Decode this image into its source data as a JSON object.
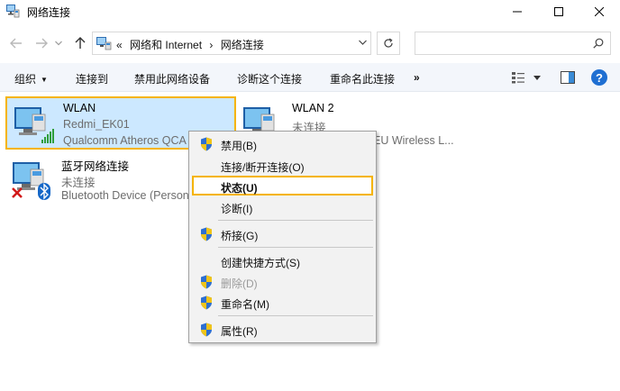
{
  "window": {
    "title": "网络连接",
    "controls": [
      "minimize-icon",
      "maximize-icon",
      "close-icon"
    ]
  },
  "nav": {
    "back_icon": "arrow-left-icon",
    "forward_icon": "arrow-right-icon",
    "recent_icon": "chevron-down-icon",
    "up_icon": "arrow-up-icon",
    "breadcrumb_prefix": "«",
    "breadcrumbs": [
      "网络和 Internet",
      "›",
      "网络连接"
    ],
    "refresh_icon": "refresh-icon",
    "search_placeholder": "",
    "search_icon": "search-icon"
  },
  "toolbar": {
    "organize": "组织",
    "connect_to": "连接到",
    "disable_device": "禁用此网络设备",
    "diagnose": "诊断这个连接",
    "rename": "重命名此连接",
    "more": "»",
    "help": "?"
  },
  "items": [
    {
      "name": "WLAN",
      "status": "Redmi_EK01",
      "device": "Qualcomm Atheros QCA",
      "selected": true
    },
    {
      "name": "WLAN 2",
      "status": "未连接",
      "device": "EU Wireless L..."
    },
    {
      "name": "蓝牙网络连接",
      "status": "未连接",
      "device": "Bluetooth Device (Person"
    }
  ],
  "context_menu": {
    "disable": "禁用(B)",
    "connect_disconnect": "连接/断开连接(O)",
    "status": "状态(U)",
    "diagnose": "诊断(I)",
    "bridge": "桥接(G)",
    "create_shortcut": "创建快捷方式(S)",
    "delete": "删除(D)",
    "rename": "重命名(M)",
    "properties": "属性(R)"
  },
  "colors": {
    "selection_bg": "#cce8ff",
    "highlight_border": "#f5b400",
    "toolbar_bg": "#f3f6fb",
    "help_blue": "#1f6fd2"
  }
}
